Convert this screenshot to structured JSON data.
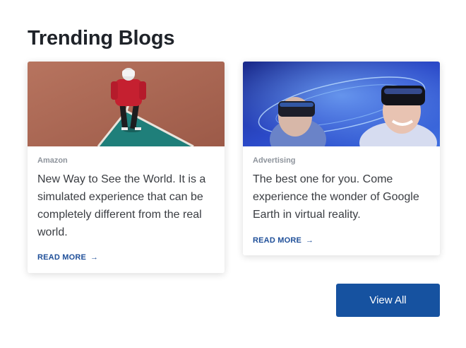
{
  "section": {
    "title": "Trending Blogs"
  },
  "cards": [
    {
      "category": "Amazon",
      "excerpt": "New Way to See the World. It is a simulated experience that can be completely different from the real world.",
      "read_more": "READ MORE",
      "image_icon": "vr-person-court-image"
    },
    {
      "category": "Advertising",
      "excerpt": "The best one for you. Come experience the wonder of Google Earth in virtual reality.",
      "read_more": "READ MORE",
      "image_icon": "vr-headsets-blue-image"
    }
  ],
  "actions": {
    "view_all": "View All"
  },
  "colors": {
    "accent": "#1652a0",
    "link": "#1f4f99",
    "category": "#8e949c"
  },
  "icons": {
    "read_more_arrow": "arrow-right-icon"
  }
}
